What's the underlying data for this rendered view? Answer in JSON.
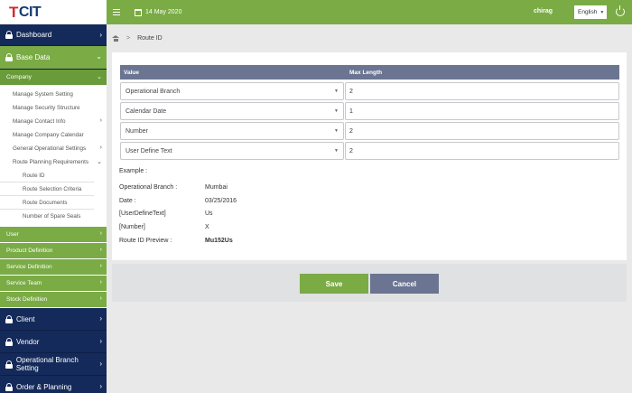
{
  "brand": {
    "logo_text": "CIT",
    "logo_mark": "T"
  },
  "topbar": {
    "date": "14 May 2020",
    "username": "chirag",
    "language": "English"
  },
  "sidebar": {
    "dashboard": "Dashboard",
    "base_data": "Base Data",
    "company": "Company",
    "company_items": [
      "Manage System Setting",
      "Manage Security Structure",
      "Manage Contact Info",
      "Manage Company Calendar",
      "General Operational Settings",
      "Route Planning Requirements"
    ],
    "route_items": [
      "Route ID",
      "Route Selection Criteria",
      "Route Documents",
      "Number of Spare Seals"
    ],
    "sections": [
      "User",
      "Product Definition",
      "Service Definition",
      "Service Team",
      "Stock Definition"
    ],
    "bottom": [
      "Client",
      "Vendor",
      "Operational Branch Setting",
      "Order & Planning"
    ]
  },
  "breadcrumb": {
    "current": "Route ID"
  },
  "table": {
    "col_value": "Value",
    "col_max": "Max Length",
    "rows": [
      {
        "value": "Operational Branch",
        "max": "2"
      },
      {
        "value": "Calendar Date",
        "max": "1"
      },
      {
        "value": "Number",
        "max": "2"
      },
      {
        "value": "User Define Text",
        "max": "2"
      }
    ]
  },
  "example": {
    "title": "Example :",
    "lines": [
      {
        "label": "Operational Branch :",
        "value": "Mumbai"
      },
      {
        "label": "Date :",
        "value": "03/25/2016"
      },
      {
        "label": "[UserDefineText]",
        "value": "Us"
      },
      {
        "label": "[Number]",
        "value": "X"
      },
      {
        "label": "Route ID Preview :",
        "value": "Mu152Us"
      }
    ]
  },
  "buttons": {
    "save": "Save",
    "cancel": "Cancel"
  },
  "colors": {
    "green": "#7aab45",
    "navy": "#142a5a",
    "slate": "#6b7592"
  }
}
